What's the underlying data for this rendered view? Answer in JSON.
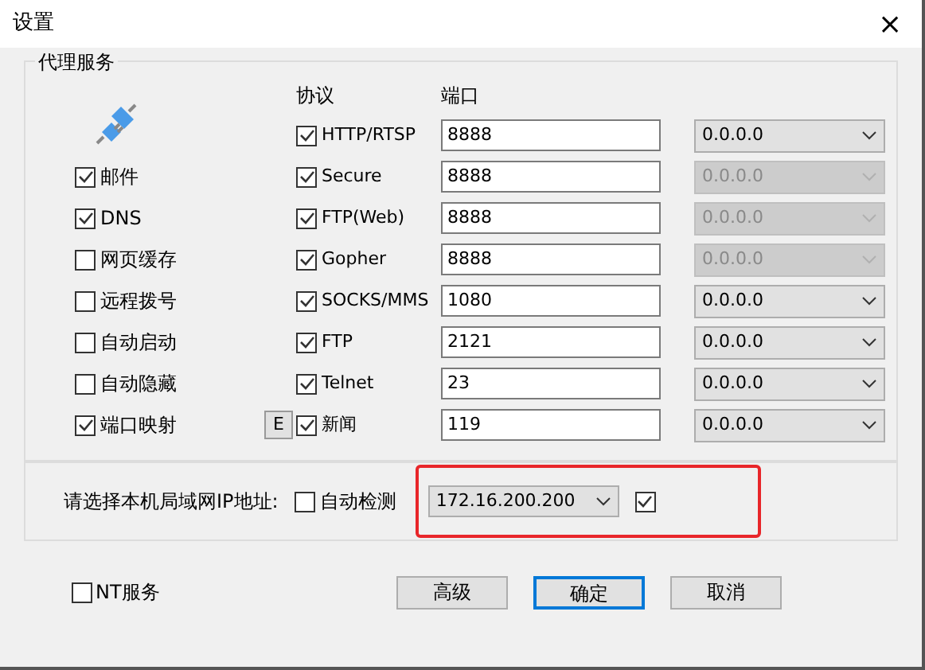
{
  "window": {
    "title": "设置",
    "close": "×"
  },
  "proxy_group": {
    "title": "代理服务",
    "protocol_header": "协议",
    "port_header": "端口",
    "options": [
      {
        "label": "邮件",
        "checked": true
      },
      {
        "label": "DNS",
        "checked": true
      },
      {
        "label": "网页缓存",
        "checked": false
      },
      {
        "label": "远程拨号",
        "checked": false
      },
      {
        "label": "自动启动",
        "checked": false
      },
      {
        "label": "自动隐藏",
        "checked": false
      },
      {
        "label": "端口映射",
        "checked": true
      }
    ],
    "mapping_button": "E",
    "protocols": [
      {
        "label": "HTTP/RTSP",
        "checked": true,
        "port": "8888",
        "address": "0.0.0.0",
        "disabled": false
      },
      {
        "label": "Secure",
        "checked": true,
        "port": "8888",
        "address": "0.0.0.0",
        "disabled": true
      },
      {
        "label": "FTP(Web)",
        "checked": true,
        "port": "8888",
        "address": "0.0.0.0",
        "disabled": true
      },
      {
        "label": "Gopher",
        "checked": true,
        "port": "8888",
        "address": "0.0.0.0",
        "disabled": true
      },
      {
        "label": "SOCKS/MMS",
        "checked": true,
        "port": "1080",
        "address": "0.0.0.0",
        "disabled": false
      },
      {
        "label": "FTP",
        "checked": true,
        "port": "2121",
        "address": "0.0.0.0",
        "disabled": false
      },
      {
        "label": "Telnet",
        "checked": true,
        "port": "23",
        "address": "0.0.0.0",
        "disabled": false
      },
      {
        "label": "新闻",
        "checked": true,
        "port": "119",
        "address": "0.0.0.0",
        "disabled": false
      }
    ]
  },
  "lan_ip": {
    "label": "请选择本机局域网IP地址:",
    "auto_detect": {
      "label": "自动检测",
      "checked": false
    },
    "address": "172.16.200.200",
    "confirm_checked": true,
    "highlighted": true
  },
  "nt_service": {
    "label": "NT服务",
    "checked": false
  },
  "buttons": [
    {
      "label": "高级",
      "default": false
    },
    {
      "label": "确定",
      "default": true
    },
    {
      "label": "取消",
      "default": false
    }
  ]
}
